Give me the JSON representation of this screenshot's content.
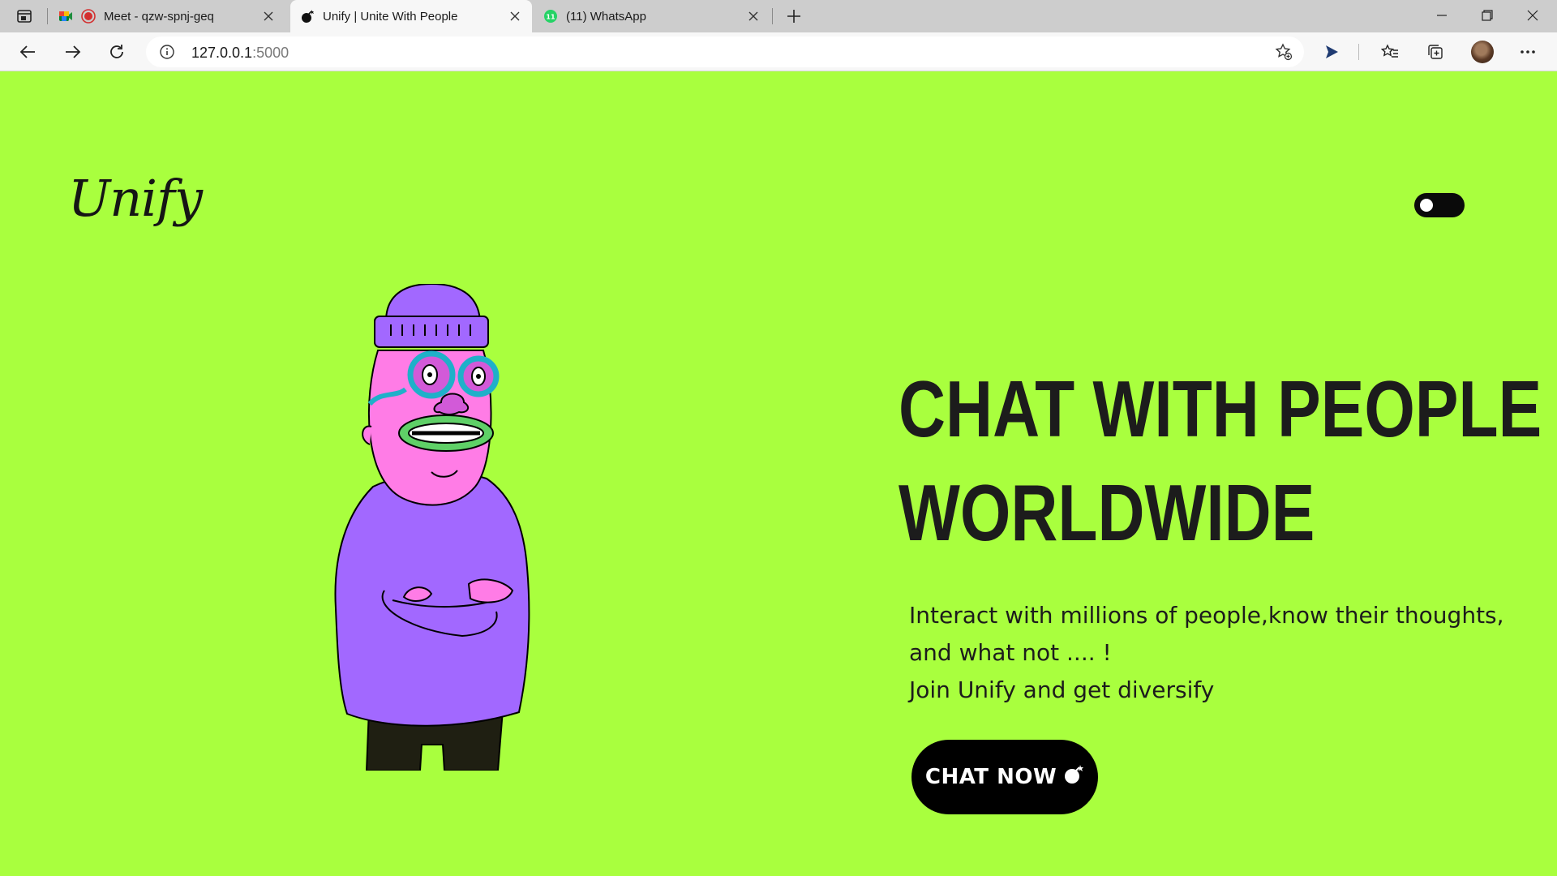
{
  "browser": {
    "tabs": [
      {
        "title": "Meet - qzw-spnj-geq",
        "active": false
      },
      {
        "title": "Unify | Unite With People",
        "active": true
      },
      {
        "title": "(11) WhatsApp",
        "active": false
      }
    ],
    "whatsapp_badge": "11",
    "address": {
      "host": "127.0.0.1",
      "port": ":5000"
    }
  },
  "page": {
    "logo_text": "Unify",
    "headline_line1": "CHAT WITH PEOPLE",
    "headline_line2": "WORLDWIDE",
    "description_line1": "Interact with millions of people,know their thoughts,",
    "description_line2": "and what not .... !",
    "description_line3": "Join Unify and get diversify",
    "cta_label": "CHAT NOW",
    "background_color": "#a9ff3e"
  }
}
